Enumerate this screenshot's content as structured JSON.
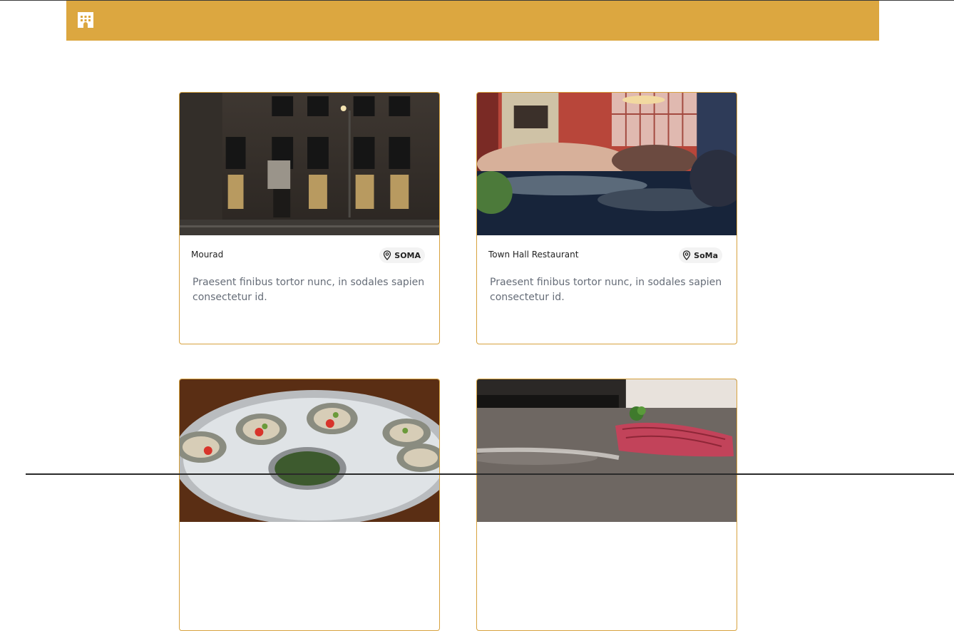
{
  "header": {
    "logo_icon": "building-icon",
    "bg_color": "#dca740"
  },
  "cards": [
    {
      "name": "Mourad",
      "neighborhood": "SOMA",
      "description": "Praesent finibus tortor nunc, in sodales sapien consectetur id.",
      "image": "night-building-photo"
    },
    {
      "name": "Town Hall Restaurant",
      "neighborhood": "SoMa",
      "description": "Praesent finibus tortor nunc, in sodales sapien consectetur id.",
      "image": "busy-dining-room-photo"
    },
    {
      "name": "",
      "neighborhood": "",
      "description": "",
      "image": "oysters-platter-photo"
    },
    {
      "name": "",
      "neighborhood": "",
      "description": "",
      "image": "tuna-nigiri-photo"
    }
  ],
  "accent_color": "#d7a23e"
}
